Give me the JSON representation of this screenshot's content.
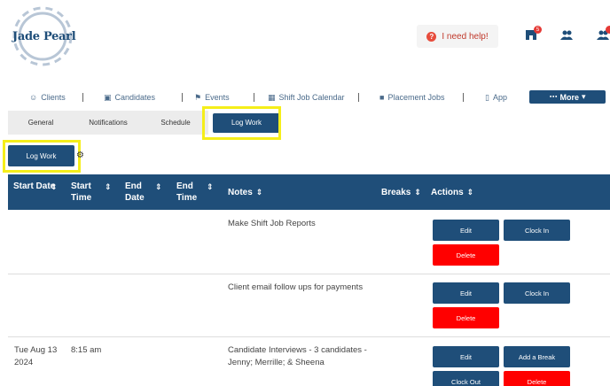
{
  "brand": {
    "name": "Jade Pearl"
  },
  "header": {
    "help_label": "I need help!",
    "store_badge": "5"
  },
  "nav": {
    "items": [
      {
        "label": "Clients"
      },
      {
        "label": "Candidates"
      },
      {
        "label": "Events"
      },
      {
        "label": "Shift Job Calendar"
      },
      {
        "label": "Placement Jobs"
      },
      {
        "label": "App"
      }
    ],
    "more_label": "More"
  },
  "tabs": [
    {
      "label": "General"
    },
    {
      "label": "Notifications"
    },
    {
      "label": "Schedule"
    },
    {
      "label": "Log Work"
    }
  ],
  "log_work_button": "Log Work",
  "table": {
    "headers": {
      "start_date": "Start Date",
      "start_time": "Start Time",
      "end_date": "End Date",
      "end_time": "End Time",
      "notes": "Notes",
      "breaks": "Breaks",
      "actions": "Actions"
    },
    "rows": [
      {
        "start_date": "",
        "start_time": "",
        "end_date": "",
        "end_time": "",
        "notes": "Make Shift Job Reports",
        "buttons": [
          "Edit",
          "Clock In",
          "Delete"
        ]
      },
      {
        "start_date": "",
        "start_time": "",
        "end_date": "",
        "end_time": "",
        "notes": "Client email follow ups for payments",
        "buttons": [
          "Edit",
          "Clock In",
          "Delete"
        ]
      },
      {
        "start_date": "Tue Aug 13 2024",
        "start_time": "8:15 am",
        "end_date": "",
        "end_time": "",
        "notes": "Candidate Interviews - 3 candidates - Jenny; Merrille; & Sheena",
        "buttons": [
          "Edit",
          "Add a Break",
          "Clock Out",
          "Delete"
        ]
      }
    ]
  }
}
